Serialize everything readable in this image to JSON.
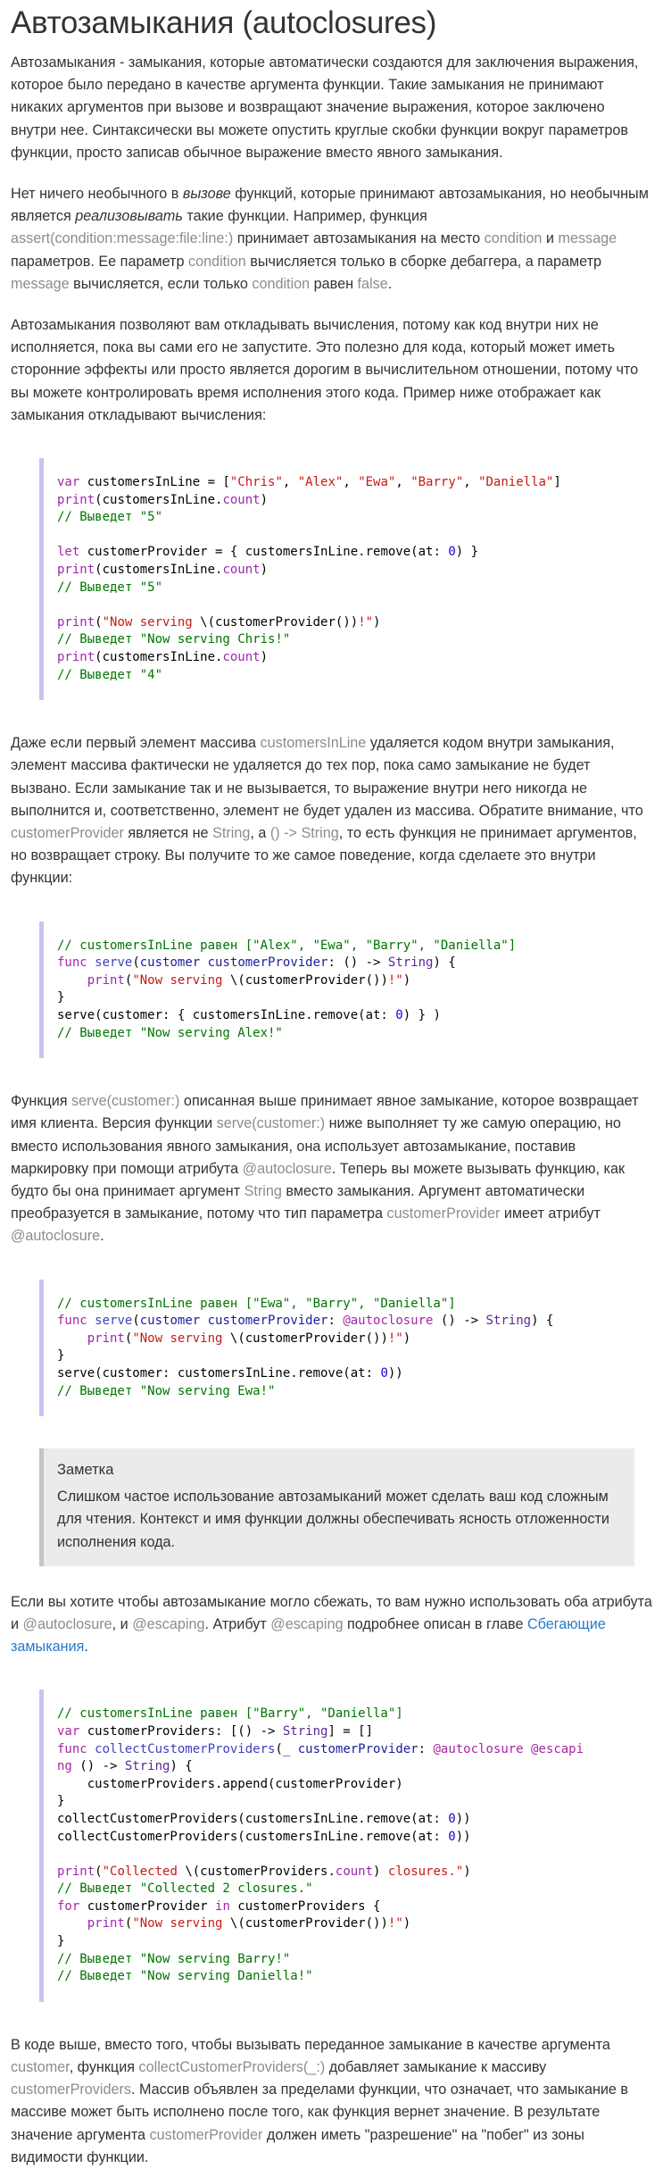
{
  "title": "Автозамыкания (autoclosures)",
  "p1": "Автозамыкания - замыкания, которые автоматически создаются для заключения выражения, которое было передано в качестве аргумента функции. Такие замыкания не принимают никаких аргументов при вызове и возвращают значение выражения, которое заключено внутри нее. Синтаксически вы можете опустить круглые скобки функции вокруг параметров функции, просто записав обычное выражение вместо явного замыкания.",
  "p2": {
    "t1": "Нет ничего необычного в ",
    "em1": "вызове",
    "t2": " функций, которые принимают автозамыкания, но необычным является ",
    "em2": "реализовывать",
    "t3": " такие функции. Например, функция ",
    "c1": "assert(condition:message:file:line:)",
    "t4": " принимает автозамыкания на место ",
    "c2": "condition",
    "t5": " и ",
    "c3": "message",
    "t6": " параметров. Ее параметр ",
    "c4": "condition",
    "t7": " вычисляется только в сборке дебаггера, а параметр ",
    "c5": "message",
    "t8": " вычисляется, если только ",
    "c6": "condition",
    "t9": " равен ",
    "c7": "false",
    "t10": "."
  },
  "p3": "Автозамыкания позволяют вам откладывать вычисления, потому как код внутри них не исполняется, пока вы сами его не запустите. Это полезно для кода, который может иметь сторонние эффекты или просто является дорогим в вычислительном отношении, потому что вы можете контролировать время исполнения этого кода. Пример ниже отображает как замыкания откладывают вычисления:",
  "p4": {
    "t1": "Даже если первый элемент массива ",
    "c1": "customersInLine",
    "t2": " удаляется кодом внутри замыкания, элемент массива фактически не удаляется до тех пор, пока само замыкание не будет вызвано. Если замыкание так и не вызывается, то выражение внутри него никогда не выполнится и, соответственно, элемент не будет удален из массива. Обратите внимание, что ",
    "c2": "customerProvider",
    "t3": " является не ",
    "c3": "String",
    "t4": ", а ",
    "c4": "() -> String",
    "t5": ", то есть функция не принимает аргументов, но возвращает строку. Вы получите то же самое поведение, когда сделаете это внутри функции:"
  },
  "p5": {
    "t1": "Функция ",
    "c1": "serve(customer:)",
    "t2": " описанная выше принимает явное замыкание, которое возвращает имя клиента. Версия функции ",
    "c2": "serve(customer:)",
    "t3": " ниже выполняет ту же самую операцию, но вместо использования явного замыкания, она использует автозамыкание, поставив маркировку при помощи атрибута ",
    "c3": "@autoclosure",
    "t4": ". Теперь вы можете вызывать функцию, как будто бы она принимает аргумент ",
    "c4": "String",
    "t5": " вместо замыкания. Аргумент автоматически преобразуется в замыкание, потому что тип параметра ",
    "c5": "customerProvider",
    "t6": " имеет атрибут ",
    "c6": "@autoclosure",
    "t7": "."
  },
  "note": {
    "title": "Заметка",
    "body": "Слишком частое использование автозамыканий может сделать ваш код сложным для чтения. Контекст и имя функции должны обеспечивать ясность отложенности исполнения кода."
  },
  "p6": {
    "t1": "Если вы хотите чтобы автозамыкание могло сбежать, то вам нужно использовать оба атрибута и ",
    "c1": "@autoclosure",
    "t2": ", и ",
    "c2": "@escaping",
    "t3": ". Атрибут ",
    "c3": "@escaping",
    "t4": " подробнее описан в главе ",
    "link": "Сбегающие замыкания",
    "t5": "."
  },
  "p7": {
    "t1": "В коде выше, вместо того, чтобы вызывать переданное замыкание в качестве аргумента ",
    "c1": "customer",
    "t2": ", функция ",
    "c2": "collectCustomerProviders(_:)",
    "t3": " добавляет замыкание к массиву ",
    "c3": "customerProviders",
    "t4": ". Массив объявлен за пределами функции, что означает, что замыкание в массиве может быть исполнено после того, как функция вернет значение. В результате значение аргумента ",
    "c4": "customerProvider",
    "t5": " должен иметь \"разрешение\" на \"побег\" из зоны видимости функции."
  },
  "code1": [
    [
      [
        "kw",
        "var"
      ],
      [
        "p",
        " customersInLine = ["
      ],
      [
        "str",
        "\"Chris\""
      ],
      [
        "p",
        ", "
      ],
      [
        "str",
        "\"Alex\""
      ],
      [
        "p",
        ", "
      ],
      [
        "str",
        "\"Ewa\""
      ],
      [
        "p",
        ", "
      ],
      [
        "str",
        "\"Barry\""
      ],
      [
        "p",
        ", "
      ],
      [
        "str",
        "\"Daniella\""
      ],
      [
        "p",
        "]"
      ]
    ],
    [
      [
        "kw2",
        "print"
      ],
      [
        "p",
        "(customersInLine."
      ],
      [
        "kw2",
        "count"
      ],
      [
        "p",
        ")"
      ]
    ],
    [
      [
        "cmt",
        "// Выведет \"5\""
      ]
    ],
    [
      [
        "p",
        ""
      ]
    ],
    [
      [
        "kw",
        "let"
      ],
      [
        "p",
        " customerProvider = { customersInLine.remove(at: "
      ],
      [
        "num",
        "0"
      ],
      [
        "p",
        ") }"
      ]
    ],
    [
      [
        "kw2",
        "print"
      ],
      [
        "p",
        "(customersInLine."
      ],
      [
        "kw2",
        "count"
      ],
      [
        "p",
        ")"
      ]
    ],
    [
      [
        "cmt",
        "// Выведет \"5\""
      ]
    ],
    [
      [
        "p",
        ""
      ]
    ],
    [
      [
        "kw2",
        "print"
      ],
      [
        "p",
        "("
      ],
      [
        "str",
        "\"Now serving "
      ],
      [
        "p",
        "\\(customerProvider())"
      ],
      [
        "str",
        "!\""
      ],
      [
        "p",
        ")"
      ]
    ],
    [
      [
        "cmt",
        "// Выведет \"Now serving Chris!\""
      ]
    ],
    [
      [
        "kw2",
        "print"
      ],
      [
        "p",
        "(customersInLine."
      ],
      [
        "kw2",
        "count"
      ],
      [
        "p",
        ")"
      ]
    ],
    [
      [
        "cmt",
        "// Выведет \"4\""
      ]
    ]
  ],
  "code2": [
    [
      [
        "cmt",
        "// customersInLine равен [\"Alex\", \"Ewa\", \"Barry\", \"Daniella\"]"
      ]
    ],
    [
      [
        "kw",
        "func"
      ],
      [
        "p",
        " "
      ],
      [
        "fn",
        "serve"
      ],
      [
        "p",
        "("
      ],
      [
        "ident",
        "customer customerProvider"
      ],
      [
        "p",
        ": () -> "
      ],
      [
        "ty",
        "String"
      ],
      [
        "p",
        ") {"
      ]
    ],
    [
      [
        "p",
        "    "
      ],
      [
        "kw2",
        "print"
      ],
      [
        "p",
        "("
      ],
      [
        "str",
        "\"Now serving "
      ],
      [
        "p",
        "\\(customerProvider())"
      ],
      [
        "str",
        "!\""
      ],
      [
        "p",
        ")"
      ]
    ],
    [
      [
        "p",
        "}"
      ]
    ],
    [
      [
        "p",
        "serve(customer: { customersInLine.remove(at: "
      ],
      [
        "num",
        "0"
      ],
      [
        "p",
        ") } )"
      ]
    ],
    [
      [
        "cmt",
        "// Выведет \"Now serving Alex!\""
      ]
    ]
  ],
  "code3": [
    [
      [
        "cmt",
        "// customersInLine равен [\"Ewa\", \"Barry\", \"Daniella\"]"
      ]
    ],
    [
      [
        "kw",
        "func"
      ],
      [
        "p",
        " "
      ],
      [
        "fn",
        "serve"
      ],
      [
        "p",
        "("
      ],
      [
        "ident",
        "customer customerProvider"
      ],
      [
        "p",
        ": "
      ],
      [
        "kw",
        "@autoclosure"
      ],
      [
        "p",
        " () -> "
      ],
      [
        "ty",
        "String"
      ],
      [
        "p",
        ") {"
      ]
    ],
    [
      [
        "p",
        "    "
      ],
      [
        "kw2",
        "print"
      ],
      [
        "p",
        "("
      ],
      [
        "str",
        "\"Now serving "
      ],
      [
        "p",
        "\\(customerProvider())"
      ],
      [
        "str",
        "!\""
      ],
      [
        "p",
        ")"
      ]
    ],
    [
      [
        "p",
        "}"
      ]
    ],
    [
      [
        "p",
        "serve(customer: customersInLine.remove(at: "
      ],
      [
        "num",
        "0"
      ],
      [
        "p",
        "))"
      ]
    ],
    [
      [
        "cmt",
        "// Выведет \"Now serving Ewa!\""
      ]
    ]
  ],
  "code4": [
    [
      [
        "cmt",
        "// customersInLine равен [\"Barry\", \"Daniella\"]"
      ]
    ],
    [
      [
        "kw",
        "var"
      ],
      [
        "p",
        " customerProviders: [() -> "
      ],
      [
        "ty",
        "String"
      ],
      [
        "p",
        "] = []"
      ]
    ],
    [
      [
        "kw",
        "func"
      ],
      [
        "p",
        " "
      ],
      [
        "fn",
        "collectCustomerProviders"
      ],
      [
        "p",
        "("
      ],
      [
        "ident",
        "_ customerProvider"
      ],
      [
        "p",
        ": "
      ],
      [
        "kw",
        "@autoclosure @escapi"
      ]
    ],
    [
      [
        "kw",
        "ng"
      ],
      [
        "p",
        " () -> "
      ],
      [
        "ty",
        "String"
      ],
      [
        "p",
        ") {"
      ]
    ],
    [
      [
        "p",
        "    customerProviders.append(customerProvider)"
      ]
    ],
    [
      [
        "p",
        "}"
      ]
    ],
    [
      [
        "p",
        "collectCustomerProviders(customersInLine.remove(at: "
      ],
      [
        "num",
        "0"
      ],
      [
        "p",
        "))"
      ]
    ],
    [
      [
        "p",
        "collectCustomerProviders(customersInLine.remove(at: "
      ],
      [
        "num",
        "0"
      ],
      [
        "p",
        "))"
      ]
    ],
    [
      [
        "p",
        ""
      ]
    ],
    [
      [
        "kw2",
        "print"
      ],
      [
        "p",
        "("
      ],
      [
        "str",
        "\"Collected "
      ],
      [
        "p",
        "\\(customerProviders."
      ],
      [
        "kw2",
        "count"
      ],
      [
        "p",
        ")"
      ],
      [
        "str",
        " closures.\""
      ],
      [
        "p",
        ")"
      ]
    ],
    [
      [
        "cmt",
        "// Выведет \"Collected 2 closures.\""
      ]
    ],
    [
      [
        "kw",
        "for"
      ],
      [
        "p",
        " customerProvider "
      ],
      [
        "kw",
        "in"
      ],
      [
        "p",
        " customerProviders {"
      ]
    ],
    [
      [
        "p",
        "    "
      ],
      [
        "kw2",
        "print"
      ],
      [
        "p",
        "("
      ],
      [
        "str",
        "\"Now serving "
      ],
      [
        "p",
        "\\(customerProvider())"
      ],
      [
        "str",
        "!\""
      ],
      [
        "p",
        ")"
      ]
    ],
    [
      [
        "p",
        "}"
      ]
    ],
    [
      [
        "cmt",
        "// Выведет \"Now serving Barry!\""
      ]
    ],
    [
      [
        "cmt",
        "// Выведет \"Now serving Daniella!\""
      ]
    ]
  ]
}
